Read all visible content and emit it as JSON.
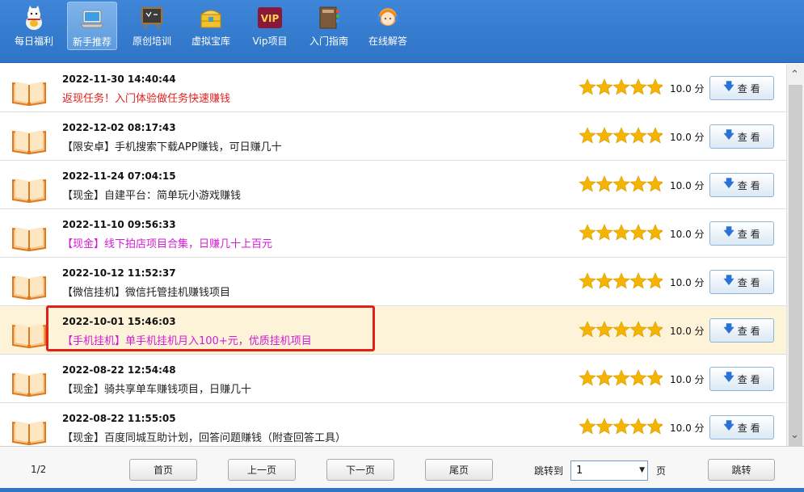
{
  "toolbar": {
    "items": [
      {
        "label": "每日福利",
        "icon": "lucky-cat-icon"
      },
      {
        "label": "新手推荐",
        "icon": "laptop-icon",
        "active": true
      },
      {
        "label": "原创培训",
        "icon": "blackboard-icon"
      },
      {
        "label": "虚拟宝库",
        "icon": "treasure-box-icon"
      },
      {
        "label": "Vip项目",
        "icon": "vip-badge-icon",
        "badge": "VIP"
      },
      {
        "label": "入门指南",
        "icon": "guide-book-icon"
      },
      {
        "label": "在线解答",
        "icon": "support-agent-icon"
      }
    ]
  },
  "list": {
    "items": [
      {
        "date": "2022-11-30 14:40:44",
        "title": "返现任务！入门体验做任务快速赚钱",
        "title_color": "#e0201b",
        "score": "10.0 分",
        "rating": 5,
        "view_label": "查 看"
      },
      {
        "date": "2022-12-02 08:17:43",
        "title": "【限安卓】手机搜索下载APP赚钱，可日赚几十",
        "title_color": "#222222",
        "score": "10.0 分",
        "rating": 5,
        "view_label": "查 看"
      },
      {
        "date": "2022-11-24 07:04:15",
        "title": "【现金】自建平台：简单玩小游戏赚钱",
        "title_color": "#222222",
        "score": "10.0 分",
        "rating": 5,
        "view_label": "查 看"
      },
      {
        "date": "2022-11-10 09:56:33",
        "title": "【现金】线下拍店项目合集，日赚几十上百元",
        "title_color": "#d21bd2",
        "score": "10.0 分",
        "rating": 5,
        "view_label": "查 看"
      },
      {
        "date": "2022-10-12 11:52:37",
        "title": "【微信挂机】微信托管挂机赚钱项目",
        "title_color": "#222222",
        "score": "10.0 分",
        "rating": 5,
        "view_label": "查 看"
      },
      {
        "date": "2022-10-01 15:46:03",
        "title": "【手机挂机】单手机挂机月入100+元，优质挂机项目",
        "title_color": "#d21bd2",
        "score": "10.0 分",
        "rating": 5,
        "view_label": "查 看",
        "highlighted": true
      },
      {
        "date": "2022-08-22 12:54:48",
        "title": "【现金】骑共享单车赚钱项目，日赚几十",
        "title_color": "#222222",
        "score": "10.0 分",
        "rating": 5,
        "view_label": "查 看"
      },
      {
        "date": "2022-08-22 11:55:05",
        "title": "【现金】百度同城互助计划，回答问题赚钱（附查回答工具）",
        "title_color": "#222222",
        "score": "10.0 分",
        "rating": 5,
        "view_label": "查 看"
      }
    ]
  },
  "pager": {
    "page_info": "1/2",
    "first_label": "首页",
    "prev_label": "上一页",
    "next_label": "下一页",
    "last_label": "尾页",
    "jump_label": "跳转到",
    "page_value": "1",
    "unit_label": "页",
    "go_label": "跳转"
  },
  "colors": {
    "toolbar_bg": "#2f74c6",
    "highlight_row": "#fdf3d9",
    "highlight_border": "#e0201b",
    "star": "#f5b400"
  }
}
